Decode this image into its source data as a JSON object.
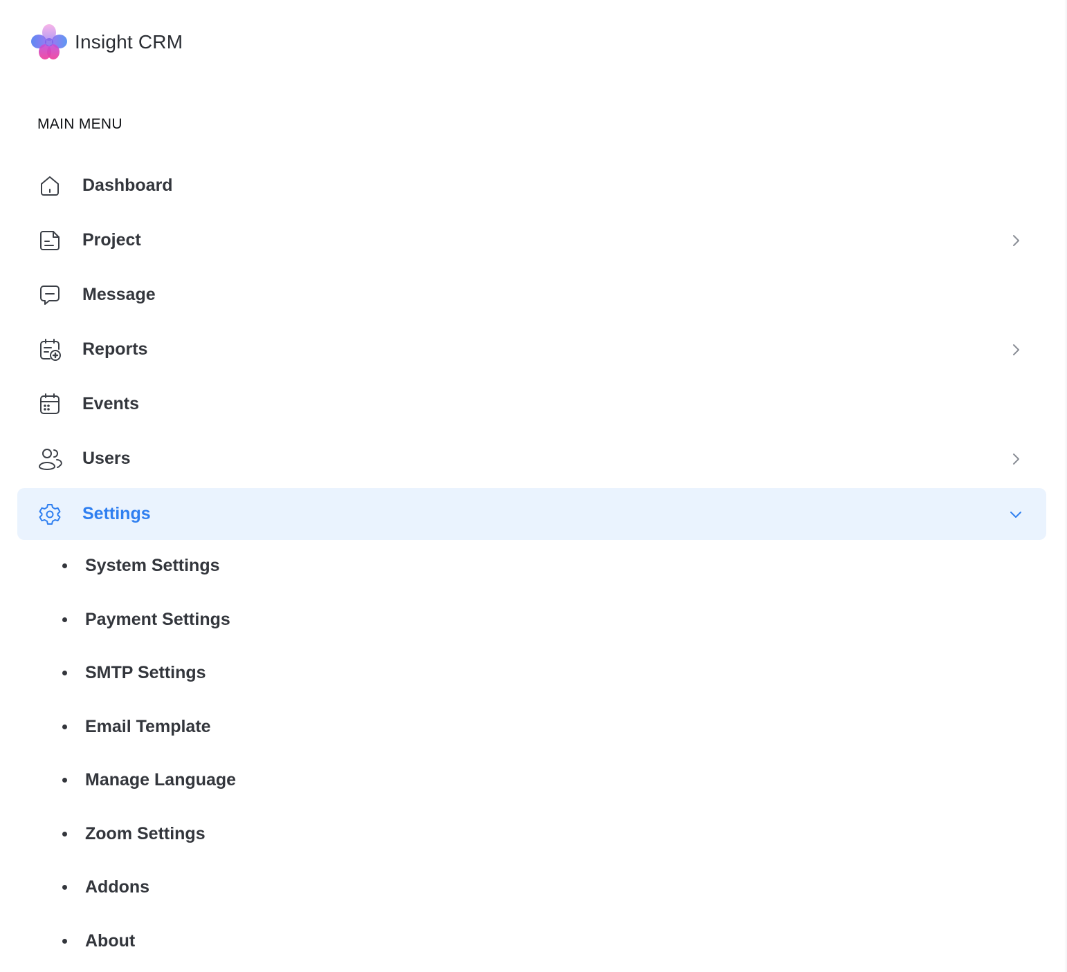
{
  "brand": {
    "name": "Insight CRM"
  },
  "menu": {
    "section_title": "MAIN MENU",
    "items": [
      {
        "label": "Dashboard",
        "icon": "home-icon",
        "has_submenu": false
      },
      {
        "label": "Project",
        "icon": "document-icon",
        "has_submenu": true
      },
      {
        "label": "Message",
        "icon": "chat-icon",
        "has_submenu": false
      },
      {
        "label": "Reports",
        "icon": "report-icon",
        "has_submenu": true
      },
      {
        "label": "Events",
        "icon": "calendar-icon",
        "has_submenu": false
      },
      {
        "label": "Users",
        "icon": "users-icon",
        "has_submenu": true
      },
      {
        "label": "Settings",
        "icon": "gear-icon",
        "has_submenu": true,
        "active": true,
        "expanded": true
      }
    ]
  },
  "settings_submenu": [
    "System Settings",
    "Payment Settings",
    "SMTP Settings",
    "Email Template",
    "Manage Language",
    "Zoom Settings",
    "Addons",
    "About"
  ],
  "colors": {
    "accent": "#2f7ff0",
    "active_bg": "#eaf3fe",
    "text": "#33363c",
    "muted_chevron": "#8a8e96"
  }
}
